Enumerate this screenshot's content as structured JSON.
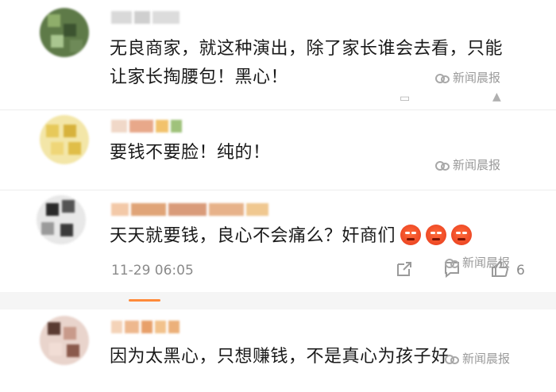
{
  "comments": [
    {
      "text_line1": "无良商家，就这种演出，除了家长谁会去看，只能",
      "text_line2": "让家长掏腰包！黑心！",
      "watermark": "新闻晨报"
    },
    {
      "text_line1": "要钱不要脸！纯的！",
      "watermark": "新闻晨报"
    },
    {
      "text_line1": "天天就要钱，良心不会痛么？奸商们",
      "time": "11-29 06:05",
      "like_count": "6",
      "watermark": "新闻晨报",
      "emoji": "angry-face"
    },
    {
      "text_line1": "因为太黑心，只想赚钱，不是真心为孩子好",
      "watermark": "新闻晨报"
    }
  ],
  "icons": {
    "share": "share-icon",
    "comment": "comment-icon",
    "like": "thumbs-up-icon"
  },
  "colors": {
    "accent": "#ff8a3a",
    "watermark": "#9a9a9a",
    "text": "#1a1a1a"
  }
}
